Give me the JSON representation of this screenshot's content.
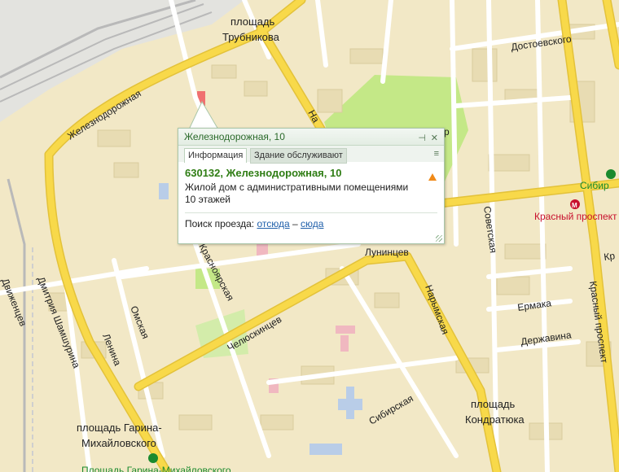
{
  "map": {
    "squares": {
      "trubnikova": [
        "площадь",
        "Трубникова"
      ],
      "kondratyuka": [
        "площадь",
        "Кондратюка"
      ],
      "garina": [
        "площадь Гарина-",
        "Михайловского"
      ]
    },
    "streets": {
      "zheleznodorozhnaya": "Железнодорожная",
      "dostoevskogo": "Достоевского",
      "lunintsev": "Лунинцев",
      "chelyuskintsev": "Челюскинцев",
      "krasnoyarskaya": "Краснoярская",
      "omskaya": "Омская",
      "lenina": "Ленина",
      "dmitriya": "Дмитрия Шамшурина",
      "dvizhentsev": "Движенцев",
      "narymskaya": "Нарымская",
      "sibirskaya": "Сибирская",
      "sovetskaya": "Советская",
      "ermaka": "Ермака",
      "derzhavina": "Державина",
      "krasny_prospekt": "Красный проспект",
      "na": "На",
      "r": "р",
      "kr": "Кр"
    },
    "metro": {
      "krasny": "Красный проспект",
      "sibirskaya": "Сибир",
      "garina_partial": "Площадь Гарина-Михайловского"
    },
    "colors": {
      "background": "#f2e8c6",
      "major_road": "#f8d94a",
      "park": "#c4e887",
      "rail": "#b9b9b9",
      "metro_red": "#c8102e",
      "metro_green": "#1a8a2e"
    }
  },
  "balloon": {
    "title": "Железнодорожная, 10",
    "pin_icon": "pin-icon",
    "close_icon": "close-icon",
    "tabs": [
      {
        "label": "Информация",
        "active": true
      },
      {
        "label": "Здание обслуживают",
        "active": false
      }
    ],
    "address": "630132, Железнодорожная, 10",
    "description_line1": "Жилой дом с административными помещениями",
    "description_line2": "10 этажей",
    "route_label": "Поиск проезда:",
    "route_from": "отсюда",
    "route_separator": "–",
    "route_to": "сюда",
    "warning_icon": "warning-icon"
  }
}
